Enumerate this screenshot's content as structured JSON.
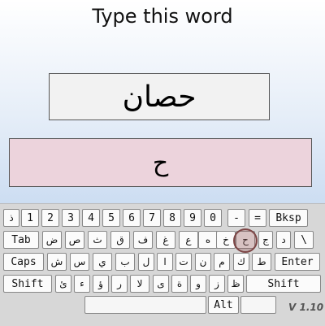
{
  "prompt": "Type this word",
  "target_word": "حصان",
  "typed_text": "ح",
  "version": "V 1.10",
  "keyboard": {
    "row1": [
      "ذ",
      "1",
      "2",
      "3",
      "4",
      "5",
      "6",
      "7",
      "8",
      "9",
      "0",
      "-",
      "=",
      "Bksp"
    ],
    "row2": [
      "Tab",
      "ض",
      "ص",
      "ث",
      "ق",
      "ف",
      "غ",
      "ع",
      "ه",
      "خ",
      "ح",
      "ج",
      "د",
      "\\"
    ],
    "row3": [
      "Caps",
      "ش",
      "س",
      "ي",
      "ب",
      "ل",
      "ا",
      "ت",
      "ن",
      "م",
      "ك",
      "ط",
      "Enter"
    ],
    "row4": [
      "Shift",
      "ئ",
      "ء",
      "ؤ",
      "ر",
      "لا",
      "ى",
      "ة",
      "و",
      "ز",
      "ظ",
      "Shift"
    ],
    "row5": [
      "",
      "Alt",
      ""
    ]
  },
  "highlighted_key": "ح"
}
